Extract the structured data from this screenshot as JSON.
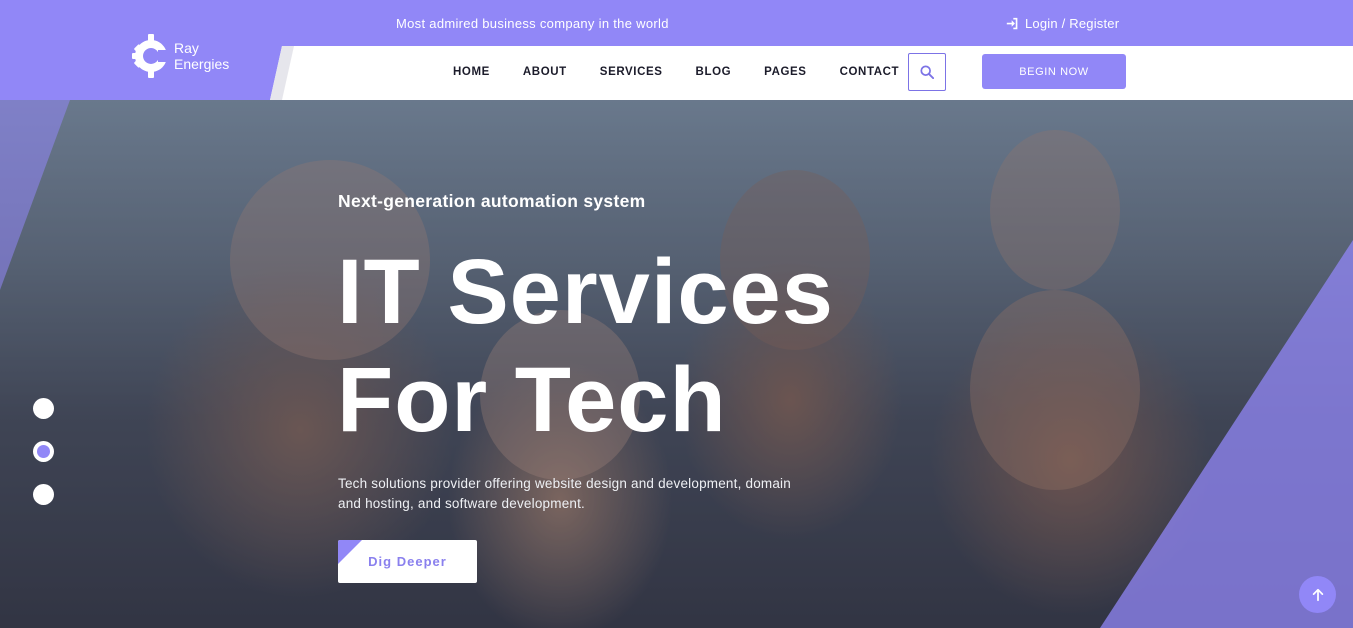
{
  "topbar": {
    "tagline": "Most admired business company in the world",
    "login_label": "Login / Register",
    "login_icon": "sign-in-icon"
  },
  "logo": {
    "line1": "Ray",
    "line2": "Energies",
    "icon": "gear-icon"
  },
  "nav": {
    "items": [
      {
        "label": "HOME"
      },
      {
        "label": "ABOUT"
      },
      {
        "label": "SERVICES"
      },
      {
        "label": "BLOG"
      },
      {
        "label": "PAGES"
      },
      {
        "label": "CONTACT"
      }
    ],
    "search_icon": "search-icon",
    "cta_label": "BEGIN NOW"
  },
  "hero": {
    "subtitle": "Next-generation automation system",
    "headline_line1": "IT Services",
    "headline_line2": "For Tech",
    "description": "Tech solutions provider offering website design and development, domain and hosting, and software development.",
    "button_label": "Dig Deeper",
    "slides": [
      {
        "active": false
      },
      {
        "active": true
      },
      {
        "active": false
      }
    ]
  },
  "scroll_top_icon": "arrow-up-icon",
  "colors": {
    "accent": "#9187f7",
    "text_dark": "#1b1b2a",
    "white": "#ffffff"
  }
}
